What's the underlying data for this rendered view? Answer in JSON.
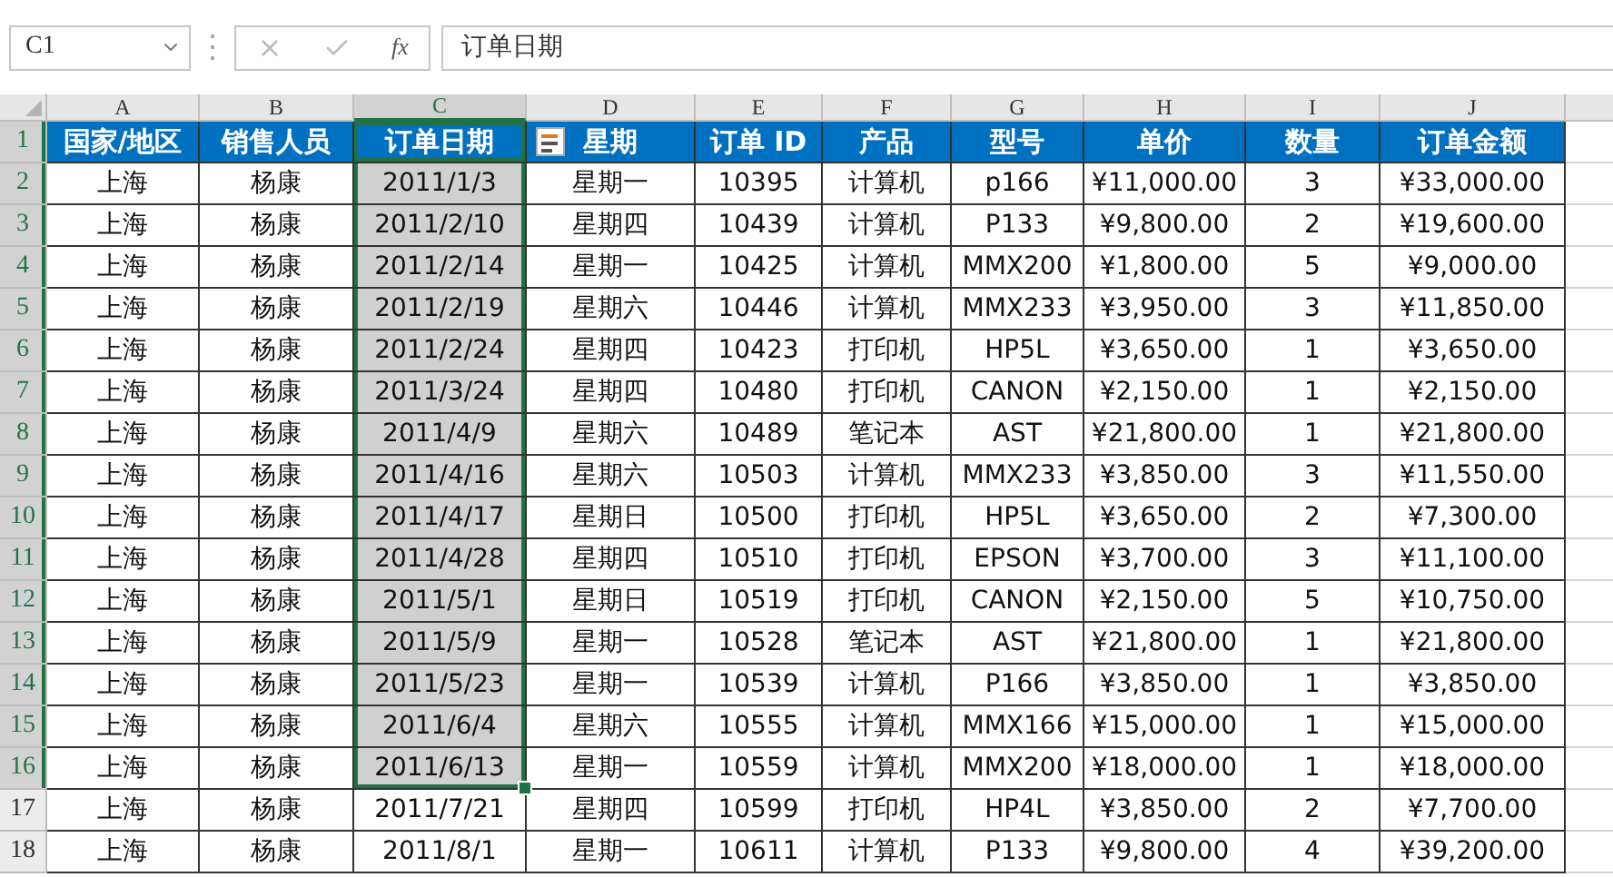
{
  "formula_bar": {
    "name_box": "C1",
    "function_label": "fx",
    "formula": "订单日期"
  },
  "columns": [
    {
      "label": "A",
      "selected": false
    },
    {
      "label": "B",
      "selected": false
    },
    {
      "label": "C",
      "selected": true
    },
    {
      "label": "D",
      "selected": false
    },
    {
      "label": "E",
      "selected": false
    },
    {
      "label": "F",
      "selected": false
    },
    {
      "label": "G",
      "selected": false
    },
    {
      "label": "H",
      "selected": false
    },
    {
      "label": "I",
      "selected": false
    },
    {
      "label": "J",
      "selected": false
    }
  ],
  "rows": [
    {
      "number": "1",
      "kind": "header",
      "selected": true,
      "cells": [
        "国家/地区",
        "销售人员",
        "订单日期",
        "星期",
        "订单 ID",
        "产品",
        "型号",
        "单价",
        "数量",
        "订单金额"
      ]
    },
    {
      "number": "2",
      "kind": "data",
      "selected": true,
      "cells": [
        "上海",
        "杨康",
        "2011/1/3",
        "星期一",
        "10395",
        "计算机",
        "p166",
        "¥11,000.00",
        "3",
        "¥33,000.00"
      ]
    },
    {
      "number": "3",
      "kind": "data",
      "selected": true,
      "cells": [
        "上海",
        "杨康",
        "2011/2/10",
        "星期四",
        "10439",
        "计算机",
        "P133",
        "¥9,800.00",
        "2",
        "¥19,600.00"
      ]
    },
    {
      "number": "4",
      "kind": "data",
      "selected": true,
      "cells": [
        "上海",
        "杨康",
        "2011/2/14",
        "星期一",
        "10425",
        "计算机",
        "MMX200",
        "¥1,800.00",
        "5",
        "¥9,000.00"
      ]
    },
    {
      "number": "5",
      "kind": "data",
      "selected": true,
      "cells": [
        "上海",
        "杨康",
        "2011/2/19",
        "星期六",
        "10446",
        "计算机",
        "MMX233",
        "¥3,950.00",
        "3",
        "¥11,850.00"
      ]
    },
    {
      "number": "6",
      "kind": "data",
      "selected": true,
      "cells": [
        "上海",
        "杨康",
        "2011/2/24",
        "星期四",
        "10423",
        "打印机",
        "HP5L",
        "¥3,650.00",
        "1",
        "¥3,650.00"
      ]
    },
    {
      "number": "7",
      "kind": "data",
      "selected": true,
      "cells": [
        "上海",
        "杨康",
        "2011/3/24",
        "星期四",
        "10480",
        "打印机",
        "CANON",
        "¥2,150.00",
        "1",
        "¥2,150.00"
      ]
    },
    {
      "number": "8",
      "kind": "data",
      "selected": true,
      "cells": [
        "上海",
        "杨康",
        "2011/4/9",
        "星期六",
        "10489",
        "笔记本",
        "AST",
        "¥21,800.00",
        "1",
        "¥21,800.00"
      ]
    },
    {
      "number": "9",
      "kind": "data",
      "selected": true,
      "cells": [
        "上海",
        "杨康",
        "2011/4/16",
        "星期六",
        "10503",
        "计算机",
        "MMX233",
        "¥3,850.00",
        "3",
        "¥11,550.00"
      ]
    },
    {
      "number": "10",
      "kind": "data",
      "selected": true,
      "cells": [
        "上海",
        "杨康",
        "2011/4/17",
        "星期日",
        "10500",
        "打印机",
        "HP5L",
        "¥3,650.00",
        "2",
        "¥7,300.00"
      ]
    },
    {
      "number": "11",
      "kind": "data",
      "selected": true,
      "cells": [
        "上海",
        "杨康",
        "2011/4/28",
        "星期四",
        "10510",
        "打印机",
        "EPSON",
        "¥3,700.00",
        "3",
        "¥11,100.00"
      ]
    },
    {
      "number": "12",
      "kind": "data",
      "selected": true,
      "cells": [
        "上海",
        "杨康",
        "2011/5/1",
        "星期日",
        "10519",
        "打印机",
        "CANON",
        "¥2,150.00",
        "5",
        "¥10,750.00"
      ]
    },
    {
      "number": "13",
      "kind": "data",
      "selected": true,
      "cells": [
        "上海",
        "杨康",
        "2011/5/9",
        "星期一",
        "10528",
        "笔记本",
        "AST",
        "¥21,800.00",
        "1",
        "¥21,800.00"
      ]
    },
    {
      "number": "14",
      "kind": "data",
      "selected": true,
      "cells": [
        "上海",
        "杨康",
        "2011/5/23",
        "星期一",
        "10539",
        "计算机",
        "P166",
        "¥3,850.00",
        "1",
        "¥3,850.00"
      ]
    },
    {
      "number": "15",
      "kind": "data",
      "selected": true,
      "cells": [
        "上海",
        "杨康",
        "2011/6/4",
        "星期六",
        "10555",
        "计算机",
        "MMX166",
        "¥15,000.00",
        "1",
        "¥15,000.00"
      ]
    },
    {
      "number": "16",
      "kind": "data",
      "selected": true,
      "cells": [
        "上海",
        "杨康",
        "2011/6/13",
        "星期一",
        "10559",
        "计算机",
        "MMX200",
        "¥18,000.00",
        "1",
        "¥18,000.00"
      ]
    },
    {
      "number": "17",
      "kind": "data",
      "selected": false,
      "cells": [
        "上海",
        "杨康",
        "2011/7/21",
        "星期四",
        "10599",
        "打印机",
        "HP4L",
        "¥3,850.00",
        "2",
        "¥7,700.00"
      ]
    },
    {
      "number": "18",
      "kind": "data",
      "selected": false,
      "cells": [
        "上海",
        "杨康",
        "2011/8/1",
        "星期一",
        "10611",
        "计算机",
        "P133",
        "¥9,800.00",
        "4",
        "¥39,200.00"
      ]
    }
  ]
}
